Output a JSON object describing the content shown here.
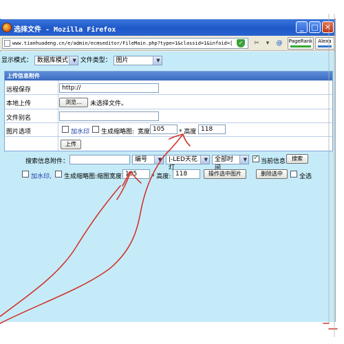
{
  "window": {
    "title": "选择文件 - Mozilla Firefox",
    "minimize_label": "_",
    "maximize_label": "□",
    "close_label": "✕"
  },
  "addressbar": {
    "url": "www.tianhuadeng.cn/e/admin/ecmseditor/FileMain.php?type=1&classid=1&infoid=[",
    "pagerank_label": "PageRank",
    "alexa_label": "Alexa"
  },
  "display": {
    "mode_label": "显示模式：",
    "mode_value": "数据库模式",
    "type_label": "文件类型：",
    "type_value": "图片"
  },
  "upload": {
    "header": "上传信息附件",
    "remote_label": "远程保存",
    "remote_value": "http://",
    "local_label": "本地上传",
    "browse_label": "浏览…",
    "no_file_text": "未选择文件。",
    "alias_label": "文件别名",
    "alias_value": "",
    "image_options_label": "图片选项",
    "watermark_label": "加水印",
    "thumb_label": "生成缩略图:",
    "width_label": "宽度",
    "width_value": "105",
    "height_label": "* 高度",
    "height_value": "118",
    "submit_label": "上传"
  },
  "search": {
    "label": "搜索信息附件：",
    "keyword_value": "",
    "field_value": "编号",
    "class_value": "|-LED天花灯",
    "time_value": "全部时间",
    "current_info_label": "当前信息",
    "current_info_checked": true,
    "search_button": "搜索"
  },
  "batch": {
    "watermark_label": "加水印,",
    "thumb_label": "生成缩略图:缩图宽度:",
    "width_value": "105",
    "height_label": "* 高度:",
    "height_value": "118",
    "operate_button": "操作选中图片",
    "delete_button": "删除选中",
    "select_all_label": "全选"
  }
}
